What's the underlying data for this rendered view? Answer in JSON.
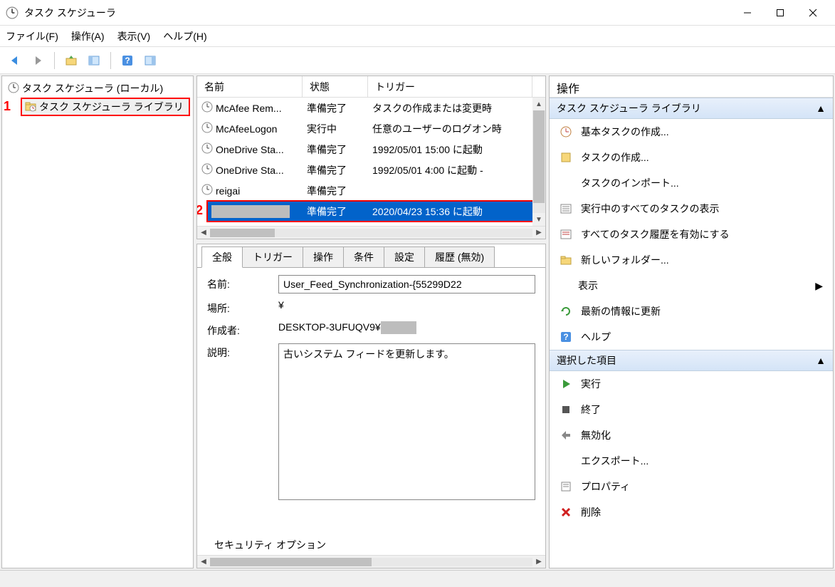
{
  "window": {
    "title": "タスク スケジューラ"
  },
  "menu": {
    "file": "ファイル(F)",
    "action": "操作(A)",
    "view": "表示(V)",
    "help": "ヘルプ(H)"
  },
  "tree": {
    "root": "タスク スケジューラ (ローカル)",
    "library": "タスク スケジューラ ライブラリ"
  },
  "annotations": {
    "one": "1",
    "two": "2"
  },
  "task_list": {
    "headers": {
      "name": "名前",
      "state": "状態",
      "trigger": "トリガー"
    },
    "rows": [
      {
        "name": "McAfee Rem...",
        "state": "準備完了",
        "trigger": "タスクの作成または変更時"
      },
      {
        "name": "McAfeeLogon",
        "state": "実行中",
        "trigger": "任意のユーザーのログオン時"
      },
      {
        "name": "OneDrive Sta...",
        "state": "準備完了",
        "trigger": "1992/05/01 15:00 に起動"
      },
      {
        "name": "OneDrive Sta...",
        "state": "準備完了",
        "trigger": "1992/05/01 4:00 に起動 -"
      },
      {
        "name": "reigai",
        "state": "準備完了",
        "trigger": ""
      },
      {
        "name": "",
        "state": "準備完了",
        "trigger": "2020/04/23 15:36 に起動",
        "selected": true,
        "redacted_name": true
      }
    ]
  },
  "tabs": {
    "general": "全般",
    "triggers": "トリガー",
    "actions": "操作",
    "conditions": "条件",
    "settings": "設定",
    "history": "履歴 (無効)"
  },
  "general_form": {
    "name_label": "名前:",
    "name_value": "User_Feed_Synchronization-{55299D22",
    "location_label": "場所:",
    "location_value": "¥",
    "author_label": "作成者:",
    "author_value": "DESKTOP-3UFUQV9¥",
    "description_label": "説明:",
    "description_value": "古いシステム フィードを更新します。",
    "security_label": "セキュリティ オプション"
  },
  "actions": {
    "header": "操作",
    "group1_title": "タスク スケジューラ ライブラリ",
    "group1_items": [
      "基本タスクの作成...",
      "タスクの作成...",
      "タスクのインポート...",
      "実行中のすべてのタスクの表示",
      "すべてのタスク履歴を有効にする",
      "新しいフォルダー...",
      "表示",
      "最新の情報に更新",
      "ヘルプ"
    ],
    "group2_title": "選択した項目",
    "group2_items": [
      "実行",
      "終了",
      "無効化",
      "エクスポート...",
      "プロパティ",
      "削除"
    ]
  }
}
